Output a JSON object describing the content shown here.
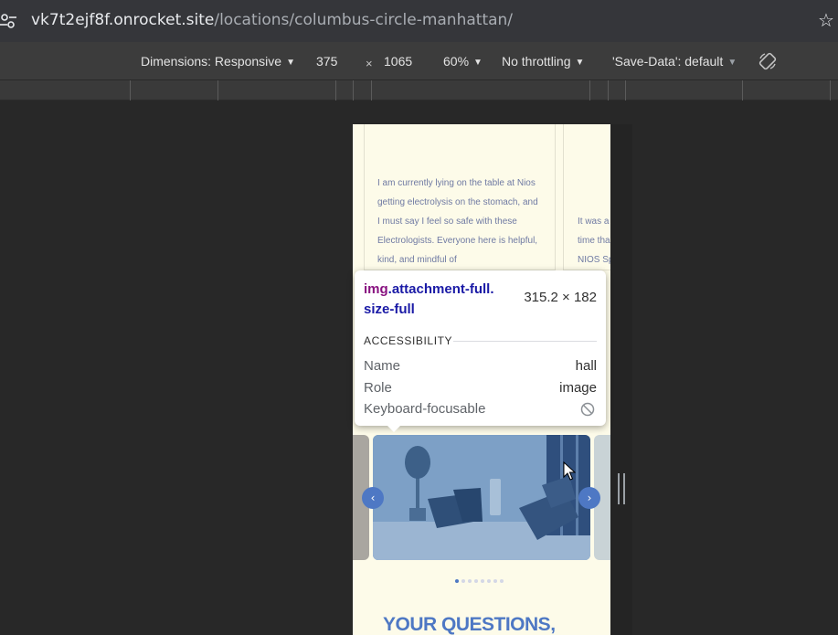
{
  "address_bar": {
    "url_host": "vk7t2ejf8f.onrocket.site",
    "url_path": "/locations/columbus-circle-manhattan/"
  },
  "device_toolbar": {
    "dimensions_label": "Dimensions: Responsive",
    "width": "375",
    "height": "1065",
    "times": "×",
    "zoom": "60%",
    "throttling": "No throttling",
    "save_data": "'Save-Data': default"
  },
  "page": {
    "review_1": "I am currently lying on the table at Nios getting electrolysis on the stomach, and I must say I feel so safe with these Electrologists. Everyone here is helpful, kind, and mindful of",
    "review_2_lines": [
      "It was a",
      "time tha",
      "NIOS Sp"
    ],
    "heading": "YOUR QUESTIONS,"
  },
  "slider": {
    "prev_icon": "‹",
    "next_icon": "›",
    "dot_count": 8,
    "active_dot": 0
  },
  "inspect_tooltip": {
    "tag": "img",
    "classes_line1": ".attachment-full.",
    "classes_line2": "size-full",
    "size": "315.2 × 182",
    "section": "ACCESSIBILITY",
    "rows": [
      {
        "label": "Name",
        "value": "hall"
      },
      {
        "label": "Role",
        "value": "image"
      },
      {
        "label": "Keyboard-focusable",
        "value": ""
      }
    ]
  },
  "colors": {
    "accent_blue": "#4e78c4",
    "page_bg": "#fdfbe9",
    "review_text": "#6f7aa3",
    "tag_purple": "#881280",
    "class_blue": "#1a1aa6"
  }
}
